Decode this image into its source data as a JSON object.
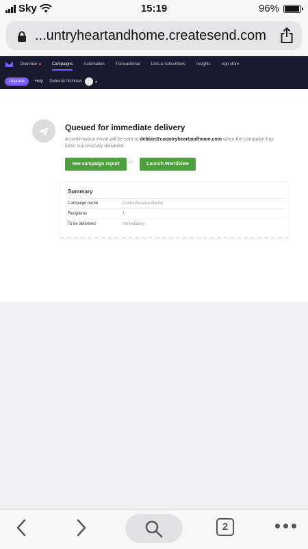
{
  "status_bar": {
    "carrier": "Sky",
    "time": "15:19",
    "battery": "96%"
  },
  "browser": {
    "url": "...untryheartandhome.createsend.com",
    "tab_count": "2"
  },
  "app_nav": {
    "items": [
      "Overview",
      "Campaigns",
      "Automation",
      "Transactional",
      "Lists & subscribers",
      "Insights",
      "App store"
    ],
    "active": "Campaigns",
    "upgrade_label": "Upgrade",
    "help_label": "Help",
    "user_name": "Deborah Nicholas",
    "caret": "▾"
  },
  "main": {
    "heading": "Queued for immediate delivery",
    "desc_prefix": "A confirmation email will be sent to ",
    "email": "debbie@countryheartandhome.com",
    "desc_suffix": " when the campaign has been successfully delivered.",
    "btn_report": "See campaign report",
    "or_label": "or",
    "btn_worldview": "Launch Worldview"
  },
  "summary": {
    "title": "Summary",
    "rows": [
      {
        "label": "Campaign name",
        "value": "Countryheartandhome"
      },
      {
        "label": "Recipients",
        "value": "1"
      },
      {
        "label": "To be delivered",
        "value": "Immediately"
      }
    ]
  },
  "colors": {
    "nav_bg": "#1a1a2e",
    "accent": "#7b5cf2",
    "button_green": "#4e9f3d"
  }
}
